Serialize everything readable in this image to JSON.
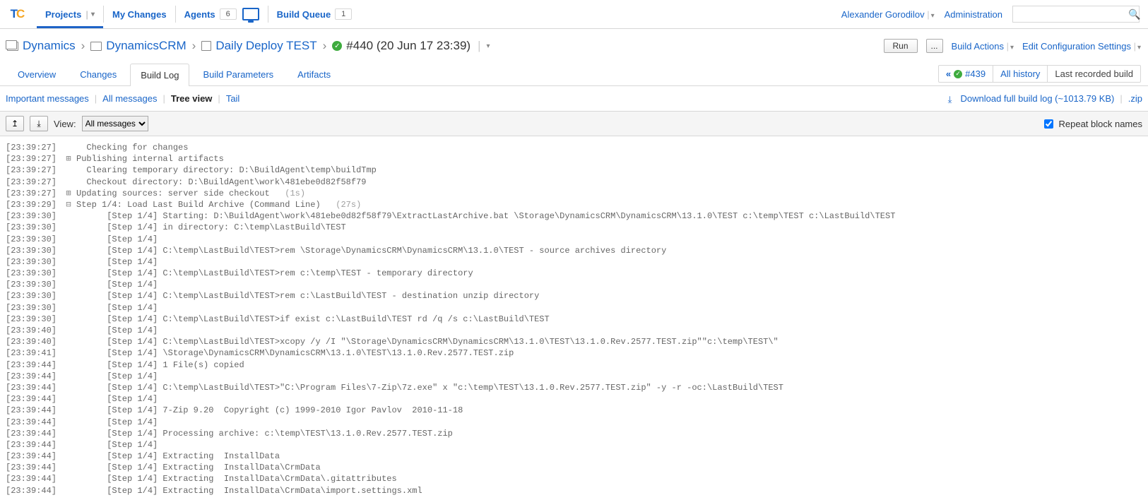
{
  "nav": {
    "projects": "Projects",
    "my_changes": "My Changes",
    "agents": "Agents",
    "agents_count": "6",
    "build_queue": "Build Queue",
    "build_queue_count": "1",
    "user_name": "Alexander Gorodilov",
    "administration": "Administration"
  },
  "breadcrumb": {
    "root": "Dynamics",
    "project": "DynamicsCRM",
    "config": "Daily Deploy TEST",
    "build": "#440 (20 Jun 17 23:39)"
  },
  "actions": {
    "run": "Run",
    "ellipsis": "...",
    "build_actions": "Build Actions",
    "edit_config": "Edit Configuration Settings"
  },
  "tabs": {
    "overview": "Overview",
    "changes": "Changes",
    "build_log": "Build Log",
    "build_params": "Build Parameters",
    "artifacts": "Artifacts"
  },
  "history": {
    "prev": "#439",
    "all": "All history",
    "last": "Last recorded build"
  },
  "msg_filter": {
    "important": "Important messages",
    "all": "All messages",
    "tree": "Tree view",
    "tail": "Tail",
    "download": "Download full build log (~1013.79 KB)",
    "zip": ".zip"
  },
  "toolbar": {
    "view_label": "View:",
    "view_option": "All messages",
    "repeat": "Repeat block names"
  },
  "log": [
    {
      "ts": "[23:39:27]",
      "t": "",
      "pad": 1,
      "msg": "Checking for changes"
    },
    {
      "ts": "[23:39:27]",
      "t": "+",
      "pad": 0,
      "msg": "Publishing internal artifacts"
    },
    {
      "ts": "[23:39:27]",
      "t": "",
      "pad": 1,
      "msg": "Clearing temporary directory: D:\\BuildAgent\\temp\\buildTmp"
    },
    {
      "ts": "[23:39:27]",
      "t": "",
      "pad": 1,
      "msg": "Checkout directory: D:\\BuildAgent\\work\\481ebe0d82f58f79"
    },
    {
      "ts": "[23:39:27]",
      "t": "+",
      "pad": 0,
      "msg": "Updating sources: server side checkout",
      "hint": "   (1s)"
    },
    {
      "ts": "[23:39:29]",
      "t": "-",
      "pad": 0,
      "msg": "Step 1/4: Load Last Build Archive (Command Line)",
      "hint": "   (27s)"
    },
    {
      "ts": "[23:39:30]",
      "t": "",
      "pad": 3,
      "msg": "[Step 1/4] Starting: D:\\BuildAgent\\work\\481ebe0d82f58f79\\ExtractLastArchive.bat \\Storage\\DynamicsCRM\\DynamicsCRM\\13.1.0\\TEST c:\\temp\\TEST c:\\LastBuild\\TEST"
    },
    {
      "ts": "[23:39:30]",
      "t": "",
      "pad": 3,
      "msg": "[Step 1/4] in directory: C:\\temp\\LastBuild\\TEST"
    },
    {
      "ts": "[23:39:30]",
      "t": "",
      "pad": 3,
      "msg": "[Step 1/4]"
    },
    {
      "ts": "[23:39:30]",
      "t": "",
      "pad": 3,
      "msg": "[Step 1/4] C:\\temp\\LastBuild\\TEST>rem \\Storage\\DynamicsCRM\\DynamicsCRM\\13.1.0\\TEST - source archives directory"
    },
    {
      "ts": "[23:39:30]",
      "t": "",
      "pad": 3,
      "msg": "[Step 1/4]"
    },
    {
      "ts": "[23:39:30]",
      "t": "",
      "pad": 3,
      "msg": "[Step 1/4] C:\\temp\\LastBuild\\TEST>rem c:\\temp\\TEST - temporary directory"
    },
    {
      "ts": "[23:39:30]",
      "t": "",
      "pad": 3,
      "msg": "[Step 1/4]"
    },
    {
      "ts": "[23:39:30]",
      "t": "",
      "pad": 3,
      "msg": "[Step 1/4] C:\\temp\\LastBuild\\TEST>rem c:\\LastBuild\\TEST - destination unzip directory"
    },
    {
      "ts": "[23:39:30]",
      "t": "",
      "pad": 3,
      "msg": "[Step 1/4]"
    },
    {
      "ts": "[23:39:30]",
      "t": "",
      "pad": 3,
      "msg": "[Step 1/4] C:\\temp\\LastBuild\\TEST>if exist c:\\LastBuild\\TEST rd /q /s c:\\LastBuild\\TEST"
    },
    {
      "ts": "[23:39:40]",
      "t": "",
      "pad": 3,
      "msg": "[Step 1/4]"
    },
    {
      "ts": "[23:39:40]",
      "t": "",
      "pad": 3,
      "msg": "[Step 1/4] C:\\temp\\LastBuild\\TEST>xcopy /y /I \"\\Storage\\DynamicsCRM\\DynamicsCRM\\13.1.0\\TEST\\13.1.0.Rev.2577.TEST.zip\"\"c:\\temp\\TEST\\\""
    },
    {
      "ts": "[23:39:41]",
      "t": "",
      "pad": 3,
      "msg": "[Step 1/4] \\Storage\\DynamicsCRM\\DynamicsCRM\\13.1.0\\TEST\\13.1.0.Rev.2577.TEST.zip"
    },
    {
      "ts": "[23:39:44]",
      "t": "",
      "pad": 3,
      "msg": "[Step 1/4] 1 File(s) copied"
    },
    {
      "ts": "[23:39:44]",
      "t": "",
      "pad": 3,
      "msg": "[Step 1/4]"
    },
    {
      "ts": "[23:39:44]",
      "t": "",
      "pad": 3,
      "msg": "[Step 1/4] C:\\temp\\LastBuild\\TEST>\"C:\\Program Files\\7-Zip\\7z.exe\" x \"c:\\temp\\TEST\\13.1.0.Rev.2577.TEST.zip\" -y -r -oc:\\LastBuild\\TEST"
    },
    {
      "ts": "[23:39:44]",
      "t": "",
      "pad": 3,
      "msg": "[Step 1/4]"
    },
    {
      "ts": "[23:39:44]",
      "t": "",
      "pad": 3,
      "msg": "[Step 1/4] 7-Zip 9.20  Copyright (c) 1999-2010 Igor Pavlov  2010-11-18"
    },
    {
      "ts": "[23:39:44]",
      "t": "",
      "pad": 3,
      "msg": "[Step 1/4]"
    },
    {
      "ts": "[23:39:44]",
      "t": "",
      "pad": 3,
      "msg": "[Step 1/4] Processing archive: c:\\temp\\TEST\\13.1.0.Rev.2577.TEST.zip"
    },
    {
      "ts": "[23:39:44]",
      "t": "",
      "pad": 3,
      "msg": "[Step 1/4]"
    },
    {
      "ts": "[23:39:44]",
      "t": "",
      "pad": 3,
      "msg": "[Step 1/4] Extracting  InstallData"
    },
    {
      "ts": "[23:39:44]",
      "t": "",
      "pad": 3,
      "msg": "[Step 1/4] Extracting  InstallData\\CrmData"
    },
    {
      "ts": "[23:39:44]",
      "t": "",
      "pad": 3,
      "msg": "[Step 1/4] Extracting  InstallData\\CrmData\\.gitattributes"
    },
    {
      "ts": "[23:39:44]",
      "t": "",
      "pad": 3,
      "msg": "[Step 1/4] Extracting  InstallData\\CrmData\\import.settings.xml"
    }
  ]
}
